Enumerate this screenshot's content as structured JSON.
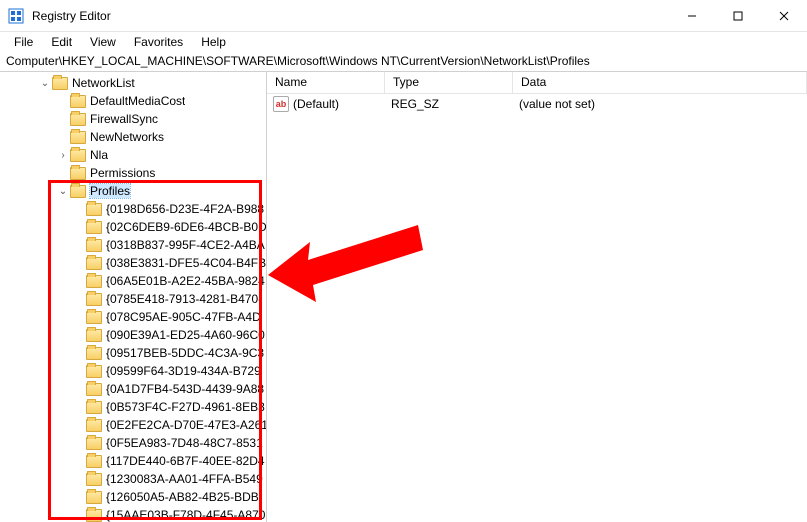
{
  "window": {
    "title": "Registry Editor"
  },
  "menu": {
    "file": "File",
    "edit": "Edit",
    "view": "View",
    "favorites": "Favorites",
    "help": "Help"
  },
  "address": "Computer\\HKEY_LOCAL_MACHINE\\SOFTWARE\\Microsoft\\Windows NT\\CurrentVersion\\NetworkList\\Profiles",
  "list": {
    "headers": {
      "name": "Name",
      "type": "Type",
      "data": "Data"
    },
    "rows": [
      {
        "name": "(Default)",
        "type": "REG_SZ",
        "data": "(value not set)"
      }
    ]
  },
  "tree": {
    "networklist": "NetworkList",
    "defaultmediacost": "DefaultMediaCost",
    "firewallsync": "FirewallSync",
    "newnetworks": "NewNetworks",
    "nla": "Nla",
    "permissions": "Permissions",
    "profiles": "Profiles",
    "guids": [
      "{0198D656-D23E-4F2A-B988",
      "{02C6DEB9-6DE6-4BCB-B0D",
      "{0318B837-995F-4CE2-A4BA",
      "{038E3831-DFE5-4C04-B4FB",
      "{06A5E01B-A2E2-45BA-9824",
      "{0785E418-7913-4281-B470-",
      "{078C95AE-905C-47FB-A4D",
      "{090E39A1-ED25-4A60-96C0",
      "{09517BEB-5DDC-4C3A-9C3",
      "{09599F64-3D19-434A-B729",
      "{0A1D7FB4-543D-4439-9A88",
      "{0B573F4C-F27D-4961-8EB3",
      "{0E2FE2CA-D70E-47E3-A261",
      "{0F5EA983-7D48-48C7-8531",
      "{117DE440-6B7F-40EE-82D4",
      "{1230083A-AA01-4FFA-B549",
      "{126050A5-AB82-4B25-BDB",
      "{15AAE03B-F78D-4F45-A870"
    ]
  }
}
